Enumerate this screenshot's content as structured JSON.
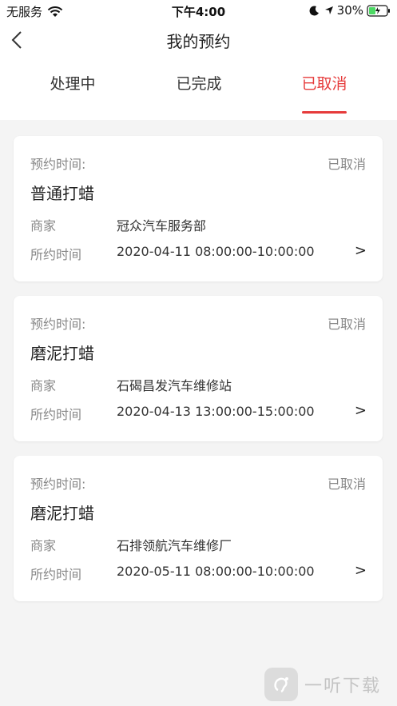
{
  "status_bar": {
    "carrier": "无服务",
    "time": "下午4:00",
    "battery": "30%"
  },
  "header": {
    "title": "我的预约"
  },
  "tabs": [
    {
      "label": "处理中"
    },
    {
      "label": "已完成"
    },
    {
      "label": "已取消",
      "active": true
    }
  ],
  "cards": [
    {
      "time_label": "预约时间:",
      "status": "已取消",
      "service": "普通打蜡",
      "merchant_label": "商家",
      "merchant": "冠众汽车服务部",
      "appt_label": "所约时间",
      "appt_time": "2020-04-11 08:00:00-10:00:00",
      "chevron": ">"
    },
    {
      "time_label": "预约时间:",
      "status": "已取消",
      "service": "磨泥打蜡",
      "merchant_label": "商家",
      "merchant": "石碣昌发汽车维修站",
      "appt_label": "所约时间",
      "appt_time": "2020-04-13 13:00:00-15:00:00",
      "chevron": ">"
    },
    {
      "time_label": "预约时间:",
      "status": "已取消",
      "service": "磨泥打蜡",
      "merchant_label": "商家",
      "merchant": "石排领航汽车维修厂",
      "appt_label": "所约时间",
      "appt_time": "2020-05-11 08:00:00-10:00:00",
      "chevron": ">"
    }
  ],
  "watermark": {
    "text": "一听下载"
  },
  "colors": {
    "accent": "#e63b3b",
    "muted": "#888888",
    "background": "#f4f4f4"
  }
}
